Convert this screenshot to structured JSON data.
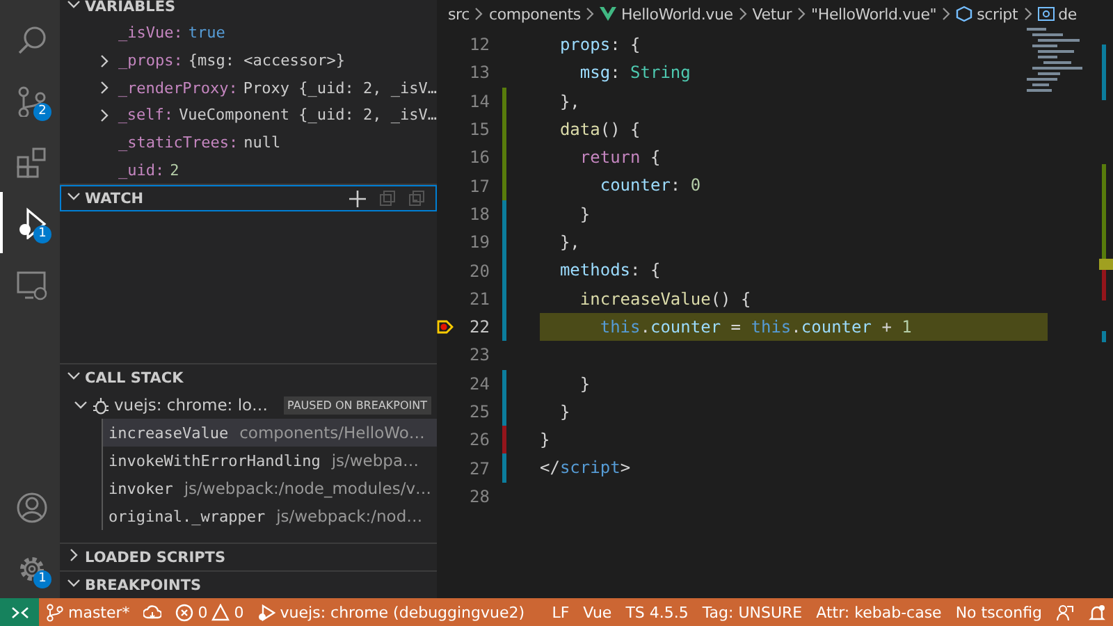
{
  "activity_bar": {
    "items": [
      {
        "kind": "search",
        "selected": false
      },
      {
        "kind": "source-control",
        "selected": false,
        "badge": "2"
      },
      {
        "kind": "extensions",
        "selected": false
      },
      {
        "kind": "debug",
        "selected": true,
        "badge": "1"
      },
      {
        "kind": "remote",
        "selected": false
      }
    ],
    "bottom_items": [
      {
        "kind": "account"
      },
      {
        "kind": "settings",
        "badge": "1"
      }
    ]
  },
  "sidebar": {
    "variables": {
      "title": "VARIABLES",
      "expanded": true,
      "items": [
        {
          "name": "_isVue:",
          "value": "true",
          "kind": "literal",
          "expandable": false
        },
        {
          "name": "_props:",
          "value": "{msg: <accessor>}",
          "kind": "object",
          "expandable": true
        },
        {
          "name": "_renderProxy:",
          "value": "Proxy {_uid: 2, _isV…",
          "kind": "object",
          "expandable": true
        },
        {
          "name": "_self:",
          "value": "VueComponent {_uid: 2, _isV…",
          "kind": "object",
          "expandable": true
        },
        {
          "name": "_staticTrees:",
          "value": "null",
          "kind": "object",
          "expandable": false
        },
        {
          "name": "_uid:",
          "value": "2",
          "kind": "number",
          "expandable": false
        }
      ]
    },
    "watch": {
      "title": "WATCH",
      "expanded": true,
      "focused": true
    },
    "call_stack": {
      "title": "CALL STACK",
      "expanded": true,
      "session": {
        "label": "vuejs: chrome: lo…",
        "badge": "PAUSED ON BREAKPOINT",
        "expanded": true
      },
      "frames": [
        {
          "name": "increaseValue",
          "source": "components/HelloWo…",
          "selected": true
        },
        {
          "name": "invokeWithErrorHandling",
          "source": "js/webpa…",
          "selected": false
        },
        {
          "name": "invoker",
          "source": "js/webpack:/node_modules/v…",
          "selected": false
        },
        {
          "name": "original._wrapper",
          "source": "js/webpack:/nod…",
          "selected": false
        }
      ]
    },
    "loaded_scripts": {
      "title": "LOADED SCRIPTS",
      "expanded": false
    },
    "breakpoints": {
      "title": "BREAKPOINTS",
      "expanded": true
    }
  },
  "editor": {
    "breadcrumbs": [
      {
        "kind": "folder",
        "text": "src"
      },
      {
        "kind": "folder",
        "text": "components"
      },
      {
        "kind": "vue",
        "text": "HelloWorld.vue"
      },
      {
        "kind": "folder",
        "text": "Vetur"
      },
      {
        "kind": "braces",
        "text": "\"HelloWorld.vue\""
      },
      {
        "kind": "module",
        "text": "script"
      },
      {
        "kind": "variable",
        "text": "de"
      }
    ],
    "lines": [
      {
        "number": "12",
        "kind": "unchanged",
        "current": false,
        "breakpoint": false,
        "tokens": [
          {
            "text": "  props",
            "kind": "property"
          },
          {
            "text": ": {",
            "kind": "punctuation"
          }
        ]
      },
      {
        "number": "13",
        "kind": "unchanged",
        "current": false,
        "breakpoint": false,
        "tokens": [
          {
            "text": "    msg",
            "kind": "property"
          },
          {
            "text": ": ",
            "kind": "punctuation"
          },
          {
            "text": "String",
            "kind": "type"
          }
        ]
      },
      {
        "number": "14",
        "kind": "added",
        "current": false,
        "breakpoint": false,
        "tokens": [
          {
            "text": "  },",
            "kind": "punctuation"
          }
        ]
      },
      {
        "number": "15",
        "kind": "added",
        "current": false,
        "breakpoint": false,
        "tokens": [
          {
            "text": "  data",
            "kind": "function"
          },
          {
            "text": "() {",
            "kind": "punctuation"
          }
        ]
      },
      {
        "number": "16",
        "kind": "added",
        "current": false,
        "breakpoint": false,
        "tokens": [
          {
            "text": "    return",
            "kind": "keyword"
          },
          {
            "text": " {",
            "kind": "punctuation"
          }
        ]
      },
      {
        "number": "17",
        "kind": "added",
        "current": false,
        "breakpoint": false,
        "tokens": [
          {
            "text": "      counter",
            "kind": "property"
          },
          {
            "text": ": ",
            "kind": "punctuation"
          },
          {
            "text": "0",
            "kind": "number"
          }
        ]
      },
      {
        "number": "18",
        "kind": "modified",
        "current": false,
        "breakpoint": false,
        "tokens": [
          {
            "text": "    }",
            "kind": "punctuation"
          }
        ]
      },
      {
        "number": "19",
        "kind": "modified",
        "current": false,
        "breakpoint": false,
        "tokens": [
          {
            "text": "  },",
            "kind": "punctuation"
          }
        ]
      },
      {
        "number": "20",
        "kind": "modified",
        "current": false,
        "breakpoint": false,
        "tokens": [
          {
            "text": "  methods",
            "kind": "property"
          },
          {
            "text": ": {",
            "kind": "punctuation"
          }
        ]
      },
      {
        "number": "21",
        "kind": "modified",
        "current": false,
        "breakpoint": false,
        "tokens": [
          {
            "text": "    increaseValue",
            "kind": "function"
          },
          {
            "text": "() {",
            "kind": "punctuation"
          }
        ]
      },
      {
        "number": "22",
        "kind": "modified",
        "current": true,
        "breakpoint": true,
        "tokens": [
          {
            "text": "      this",
            "kind": "this"
          },
          {
            "text": ".",
            "kind": "punctuation"
          },
          {
            "text": "counter",
            "kind": "property"
          },
          {
            "text": " = ",
            "kind": "punctuation"
          },
          {
            "text": "this",
            "kind": "this"
          },
          {
            "text": ".",
            "kind": "punctuation"
          },
          {
            "text": "counter",
            "kind": "property"
          },
          {
            "text": " + ",
            "kind": "punctuation"
          },
          {
            "text": "1",
            "kind": "number"
          }
        ]
      },
      {
        "number": "23",
        "kind": "unchanged",
        "current": false,
        "breakpoint": false
      },
      {
        "number": "24",
        "kind": "modified",
        "current": false,
        "breakpoint": false,
        "tokens": [
          {
            "text": "    }",
            "kind": "punctuation"
          }
        ]
      },
      {
        "number": "25",
        "kind": "modified",
        "current": false,
        "breakpoint": false,
        "tokens": [
          {
            "text": "  }",
            "kind": "punctuation"
          }
        ]
      },
      {
        "number": "26",
        "kind": "deleted",
        "current": false,
        "breakpoint": false,
        "tokens": [
          {
            "text": "}",
            "kind": "punctuation"
          }
        ]
      },
      {
        "number": "27",
        "kind": "modified",
        "current": false,
        "breakpoint": false,
        "tokens": [
          {
            "text": "</",
            "kind": "punctuation"
          },
          {
            "text": "script",
            "kind": "tag"
          },
          {
            "text": ">",
            "kind": "punctuation"
          }
        ]
      },
      {
        "number": "28",
        "kind": "unchanged",
        "current": false,
        "breakpoint": false
      }
    ]
  },
  "status_bar": {
    "left": [
      {
        "kind": "remote"
      },
      {
        "kind": "branch",
        "text": "master*"
      },
      {
        "kind": "sync"
      },
      {
        "kind": "problems",
        "errors": "0",
        "warnings": "0"
      },
      {
        "kind": "debug",
        "text": "vuejs: chrome (debuggingvue2)"
      }
    ],
    "right": [
      {
        "kind": "text",
        "text": "LF"
      },
      {
        "kind": "text",
        "text": "Vue"
      },
      {
        "kind": "text",
        "text": "TS 4.5.5"
      },
      {
        "kind": "text",
        "text": "Tag: UNSURE"
      },
      {
        "kind": "text",
        "text": "Attr: kebab-case"
      },
      {
        "kind": "text",
        "text": "No tsconfig"
      },
      {
        "kind": "feedback"
      },
      {
        "kind": "bell"
      }
    ]
  }
}
